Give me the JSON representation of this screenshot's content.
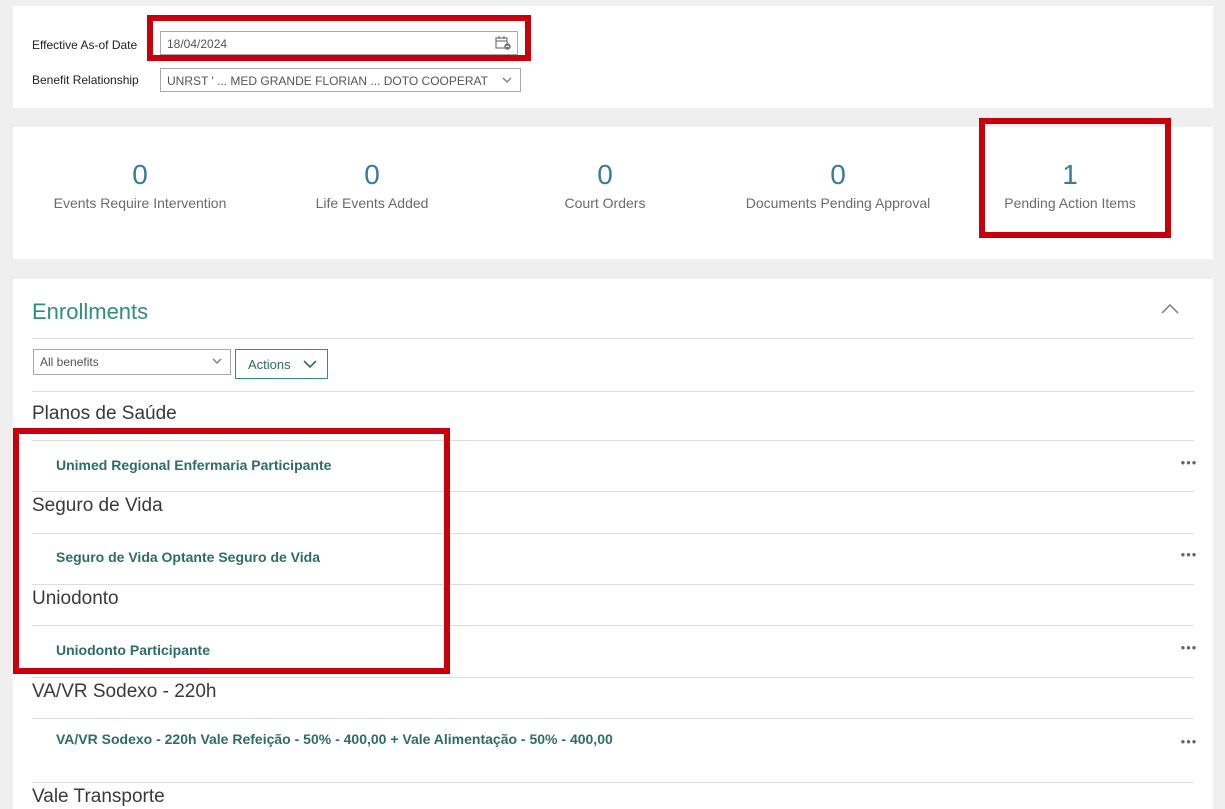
{
  "header": {
    "effective_date_label": "Effective As-of Date",
    "effective_date_value": "18/04/2024",
    "benefit_relationship_label": "Benefit Relationship",
    "benefit_relationship_value": "UNRST ' ... MED GRANDE FLORIAN ... DOTO COOPERAT"
  },
  "stats": [
    {
      "value": "0",
      "label": "Events Require Intervention"
    },
    {
      "value": "0",
      "label": "Life Events Added"
    },
    {
      "value": "0",
      "label": "Court Orders"
    },
    {
      "value": "0",
      "label": "Documents Pending Approval"
    },
    {
      "value": "1",
      "label": "Pending Action Items"
    }
  ],
  "enrollments": {
    "title": "Enrollments",
    "filter_value": "All benefits",
    "actions_label": "Actions",
    "groups": [
      {
        "name": "Planos de Saúde",
        "plan": "Unimed Regional Enfermaria Participante"
      },
      {
        "name": "Seguro de Vida",
        "plan": "Seguro de Vida Optante Seguro de Vida"
      },
      {
        "name": "Uniodonto",
        "plan": "Uniodonto Participante"
      },
      {
        "name": "VA/VR Sodexo - 220h",
        "plan": "VA/VR Sodexo - 220h Vale Refeição - 50% - 400,00 + Vale Alimentação - 50% - 400,00"
      },
      {
        "name": "Vale Transporte",
        "plan": ""
      }
    ]
  },
  "colors": {
    "accent": "#2e8d85",
    "highlight": "#c8000e",
    "stat_number": "#3a7aa0"
  }
}
